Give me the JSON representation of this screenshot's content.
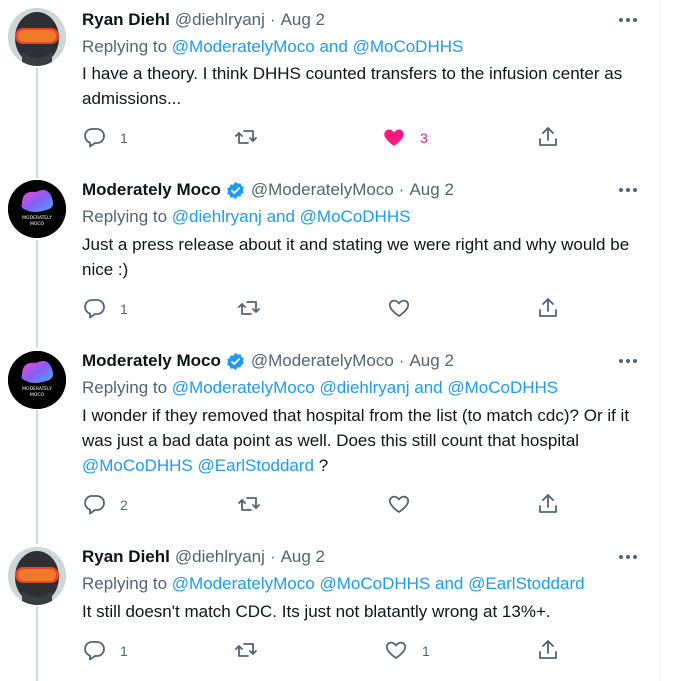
{
  "tweets": [
    {
      "name": "Ryan Diehl",
      "handle": "@diehlryanj",
      "dot": "·",
      "date": "Aug 2",
      "verified": false,
      "replying_label": "Replying to",
      "mentions": [
        "@ModeratelyMoco",
        "and",
        "@MoCoDHHS"
      ],
      "text": "I have a theory.  I think DHHS counted transfers to the infusion center as admissions...",
      "reply_count": "1",
      "retweet_count": "",
      "like_count": "3",
      "liked": true
    },
    {
      "name": "Moderately Moco",
      "handle": "@ModeratelyMoco",
      "dot": "·",
      "date": "Aug 2",
      "verified": true,
      "replying_label": "Replying to",
      "mentions": [
        "@diehlryanj",
        "and",
        "@MoCoDHHS"
      ],
      "text": "Just a press release about it and stating we were right and why would be nice :)",
      "reply_count": "1",
      "retweet_count": "",
      "like_count": "",
      "liked": false
    },
    {
      "name": "Moderately Moco",
      "handle": "@ModeratelyMoco",
      "dot": "·",
      "date": "Aug 2",
      "verified": true,
      "replying_label": "Replying to",
      "mentions": [
        "@ModeratelyMoco",
        "@diehlryanj",
        "and",
        "@MoCoDHHS"
      ],
      "text_parts": [
        "I wonder if they removed that hospital from the list (to match cdc)? Or if it was just a bad data point as well. Does this still count that hospital ",
        "@MoCoDHHS",
        " ",
        "@EarlStoddard",
        " ?"
      ],
      "reply_count": "2",
      "retweet_count": "",
      "like_count": "",
      "liked": false
    },
    {
      "name": "Ryan Diehl",
      "handle": "@diehlryanj",
      "dot": "·",
      "date": "Aug 2",
      "verified": false,
      "replying_label": "Replying to",
      "mentions": [
        "@ModeratelyMoco",
        "@MoCoDHHS",
        "and",
        "@EarlStoddard"
      ],
      "text": "It still doesn't match CDC.  Its just not blatantly wrong at 13%+.",
      "reply_count": "1",
      "retweet_count": "",
      "like_count": "1",
      "liked": false
    }
  ],
  "avatar_text": {
    "moco_line1": "MODERATELY",
    "moco_line2": "MOCO"
  },
  "colors": {
    "link": "#1d9bf0",
    "like": "#f91880",
    "muted": "#536471",
    "verified": "#1d9bf0"
  },
  "icons": {
    "reply": "reply-icon",
    "retweet": "retweet-icon",
    "like": "heart-icon",
    "share": "share-icon",
    "more": "more-icon"
  }
}
